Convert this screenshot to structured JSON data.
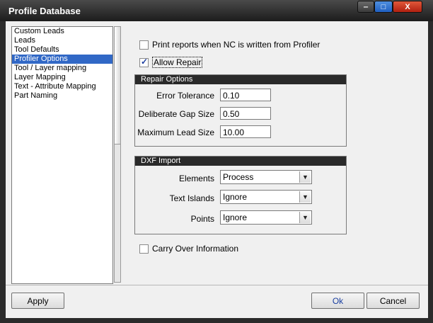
{
  "window": {
    "title": "Profile Database",
    "controls": {
      "minimize_glyph": "‒",
      "maximize_glyph": "□",
      "close_glyph": "X"
    }
  },
  "nav": {
    "items": [
      {
        "label": "Custom Leads"
      },
      {
        "label": "Leads"
      },
      {
        "label": "Tool Defaults"
      },
      {
        "label": "Profiler Options"
      },
      {
        "label": "Tool / Layer mapping"
      },
      {
        "label": "Layer Mapping"
      },
      {
        "label": "Text - Attribute Mapping"
      },
      {
        "label": "Part Naming"
      }
    ],
    "selected_index": 3
  },
  "options": {
    "print_reports": {
      "label": "Print reports when NC is written from Profiler",
      "checked": false
    },
    "allow_repair": {
      "label": "Allow Repair",
      "checked": true
    },
    "carry_over": {
      "label": "Carry Over Information",
      "checked": false
    }
  },
  "repair": {
    "title": "Repair Options",
    "fields": [
      {
        "label": "Error Tolerance",
        "value": "0.10"
      },
      {
        "label": "Deliberate Gap Size",
        "value": "0.50"
      },
      {
        "label": "Maximum Lead Size",
        "value": "10.00"
      }
    ]
  },
  "dxf": {
    "title": "DXF Import",
    "fields": [
      {
        "label": "Elements",
        "value": "Process"
      },
      {
        "label": "Text Islands",
        "value": "Ignore"
      },
      {
        "label": "Points",
        "value": "Ignore"
      }
    ]
  },
  "buttons": {
    "apply": "Apply",
    "ok": "Ok",
    "cancel": "Cancel"
  },
  "colors": {
    "selection": "#3168c6",
    "titlebar": "#1c1c1c",
    "close": "#c42a14"
  }
}
